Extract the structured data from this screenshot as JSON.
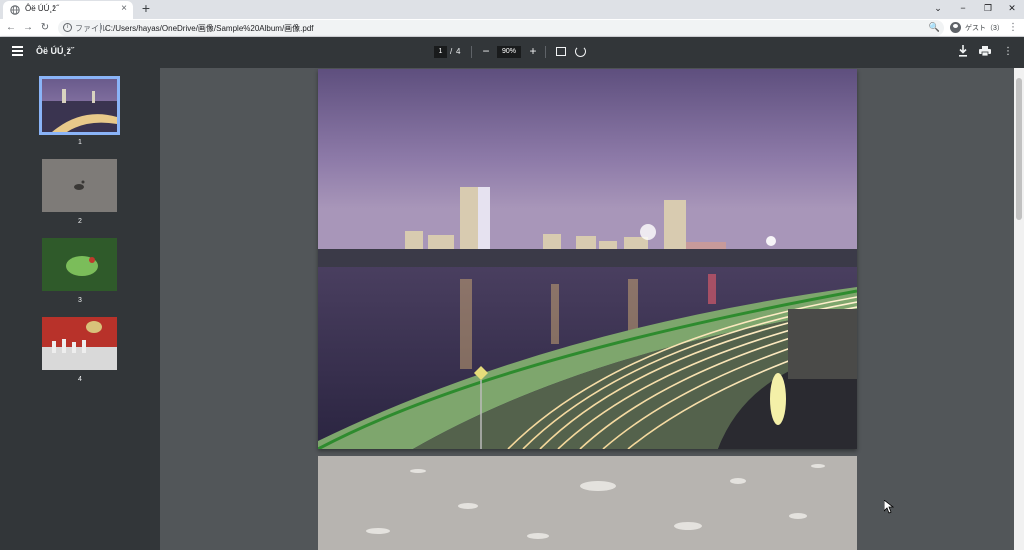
{
  "tab": {
    "title": "Ôë ÚÚ¸ž˝",
    "close": "×"
  },
  "newtab": "+",
  "window": {
    "collapse": "⌄",
    "minimize": "−",
    "restore": "❐",
    "close": "✕"
  },
  "nav": {
    "back": "←",
    "forward": "→",
    "reload": "↻"
  },
  "address": {
    "info": "i",
    "file_label": "ファイル",
    "url": "C:/Users/hayas/OneDrive/画像/Sample%20Album/画像.pdf",
    "zoom_icon": "🔍"
  },
  "profile": {
    "name": "ゲスト（3）"
  },
  "browser_menu": "⋮",
  "pdf": {
    "title": "Ôë ÚÚ¸ž˝",
    "current_page": "1",
    "slash": "/",
    "total_pages": "4",
    "zoom_out": "−",
    "zoom": "90%",
    "zoom_in": "+",
    "more": "⋮"
  },
  "thumbnails": [
    {
      "label": "1",
      "selected": true
    },
    {
      "label": "2",
      "selected": false
    },
    {
      "label": "3",
      "selected": false
    },
    {
      "label": "4",
      "selected": false
    }
  ],
  "colors": {
    "accent": "#8ab4f8",
    "toolbar": "#323639",
    "viewer_bg": "#525659"
  }
}
